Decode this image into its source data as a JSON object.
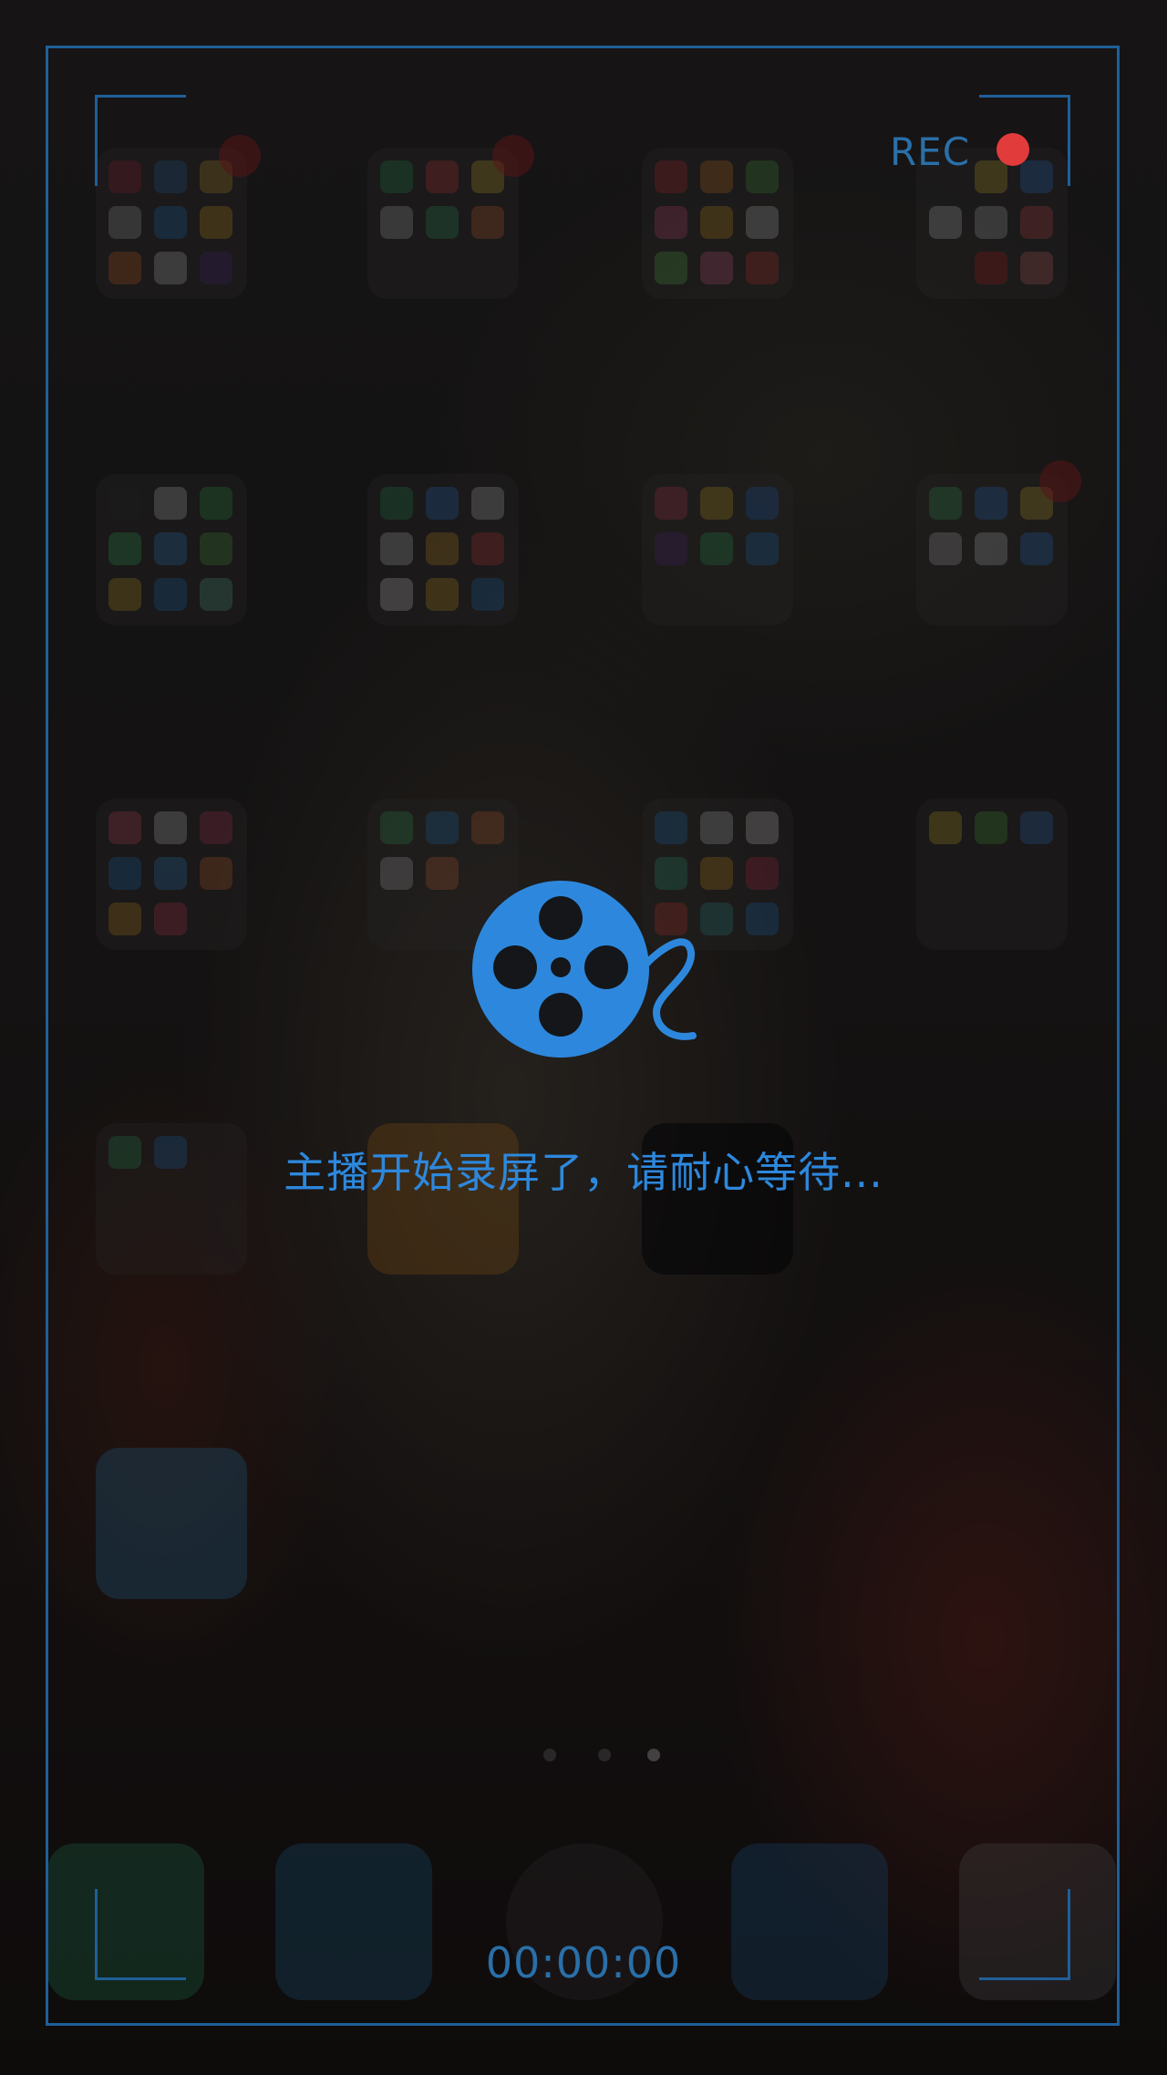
{
  "overlay": {
    "rec_label": "REC",
    "message": "主播开始录屏了，请耐心等待...",
    "timer": "00:00:00"
  },
  "colors": {
    "frame": "#1f5f99",
    "accent": "#2d88dd",
    "rec_dot": "#e23b3b"
  },
  "icons": {
    "reel": "film-reel-icon",
    "rec_indicator": "record-dot-icon"
  }
}
